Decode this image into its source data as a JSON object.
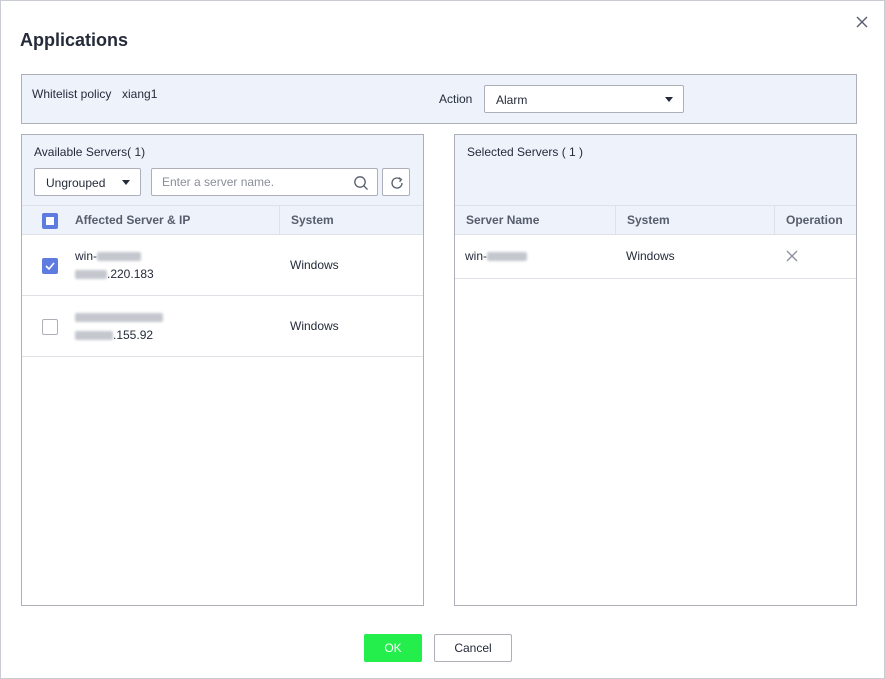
{
  "dialog": {
    "title": "Applications",
    "close_icon": "close-icon"
  },
  "policy": {
    "label": "Whitelist policy",
    "value": "xiang1",
    "action_label": "Action",
    "action_value": "Alarm"
  },
  "available": {
    "title": "Available Servers( 1)",
    "group_value": "Ungrouped",
    "search_placeholder": "Enter a server name.",
    "columns": {
      "server": "Affected Server & IP",
      "system": "System"
    },
    "rows": [
      {
        "name_prefix": "win-",
        "ip_suffix": ".220.183",
        "system": "Windows",
        "checked": true
      },
      {
        "name_prefix": "",
        "ip_suffix": ".155.92",
        "system": "Windows",
        "checked": false
      }
    ]
  },
  "selected": {
    "title": "Selected Servers ( 1 )",
    "columns": {
      "name": "Server Name",
      "system": "System",
      "operation": "Operation"
    },
    "rows": [
      {
        "name_prefix": "win-",
        "system": "Windows"
      }
    ]
  },
  "footer": {
    "ok_label": "OK",
    "cancel_label": "Cancel"
  },
  "colors": {
    "accent": "#5e7ce0",
    "ok_button": "#23ee4b",
    "header_bg": "#eef2fb"
  }
}
